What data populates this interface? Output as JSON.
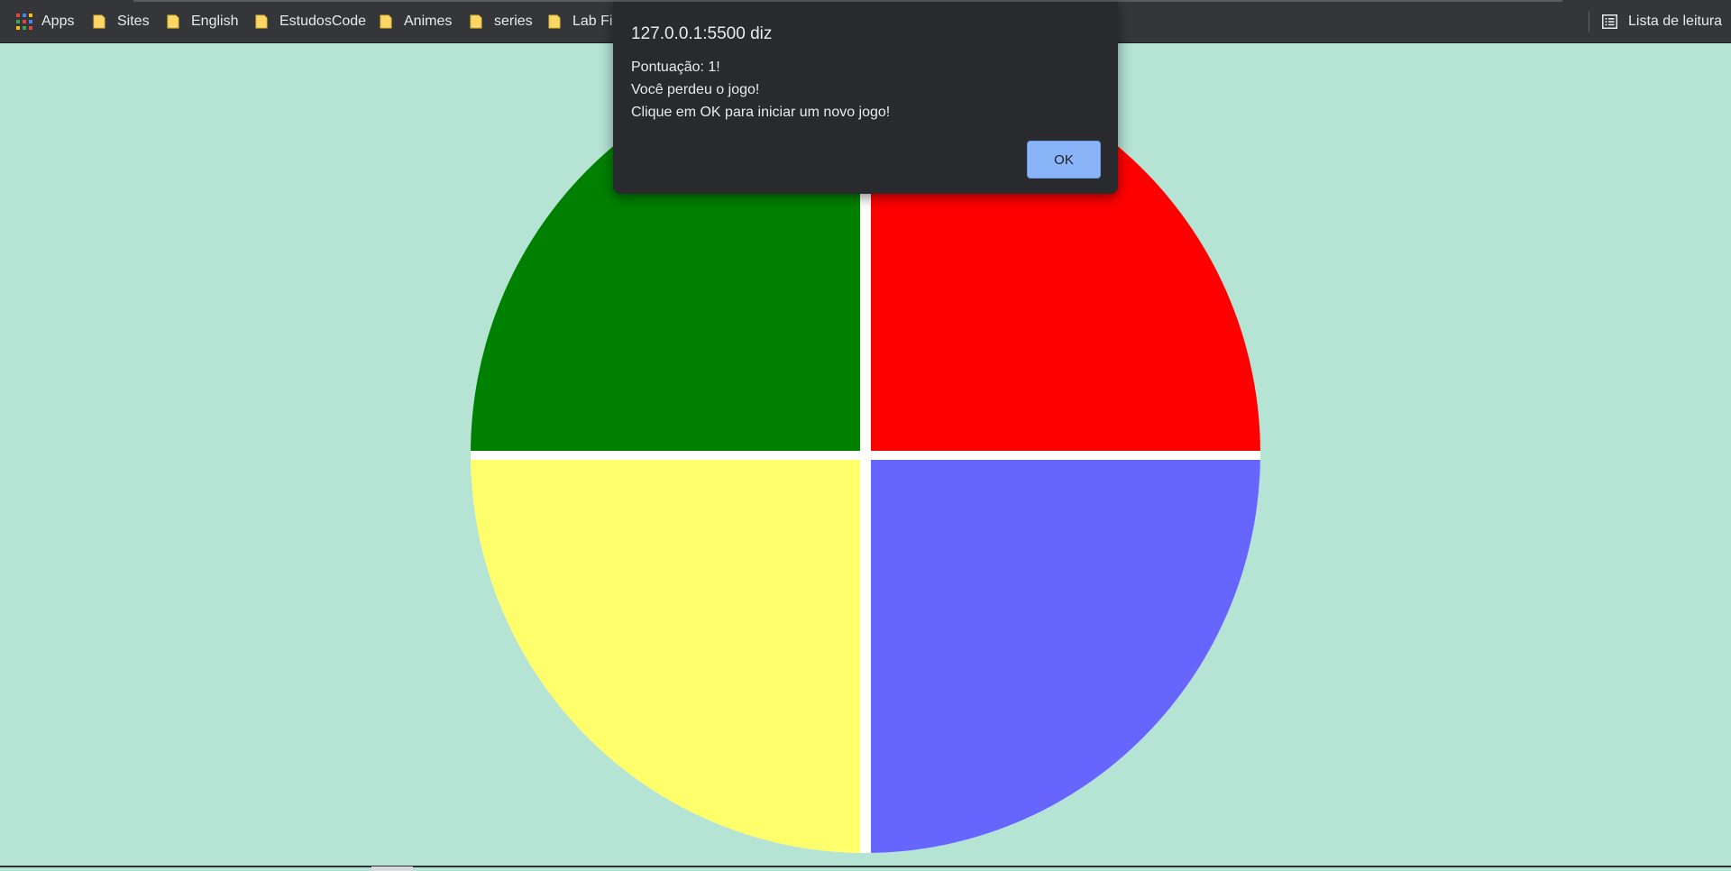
{
  "bookmarks_bar": {
    "apps_label": "Apps",
    "items": [
      {
        "label": "Sites"
      },
      {
        "label": "English"
      },
      {
        "label": "EstudosCode"
      },
      {
        "label": "Animes"
      },
      {
        "label": "series"
      },
      {
        "label": "Lab Fis"
      }
    ],
    "reading_list_label": "Lista de leitura",
    "apps_icon_colors": [
      "#ea4335",
      "#4285f4",
      "#fbbc05",
      "#34a853",
      "#ea4335",
      "#4285f4",
      "#fbbc05",
      "#34a853",
      "#ea4335"
    ],
    "folder_color": "#fdd663"
  },
  "game": {
    "quadrants": [
      {
        "name": "green",
        "color": "#008000"
      },
      {
        "name": "red",
        "color": "#ff0000"
      },
      {
        "name": "yellow",
        "color": "#ffff6c"
      },
      {
        "name": "blue",
        "color": "#6666ff"
      }
    ],
    "background_color": "#b5e3d4"
  },
  "dialog": {
    "title": "127.0.0.1:5500 diz",
    "lines": [
      "Pontuação: 1!",
      "Você perdeu o jogo!",
      "Clique em OK para iniciar um novo jogo!"
    ],
    "ok_label": "OK"
  }
}
